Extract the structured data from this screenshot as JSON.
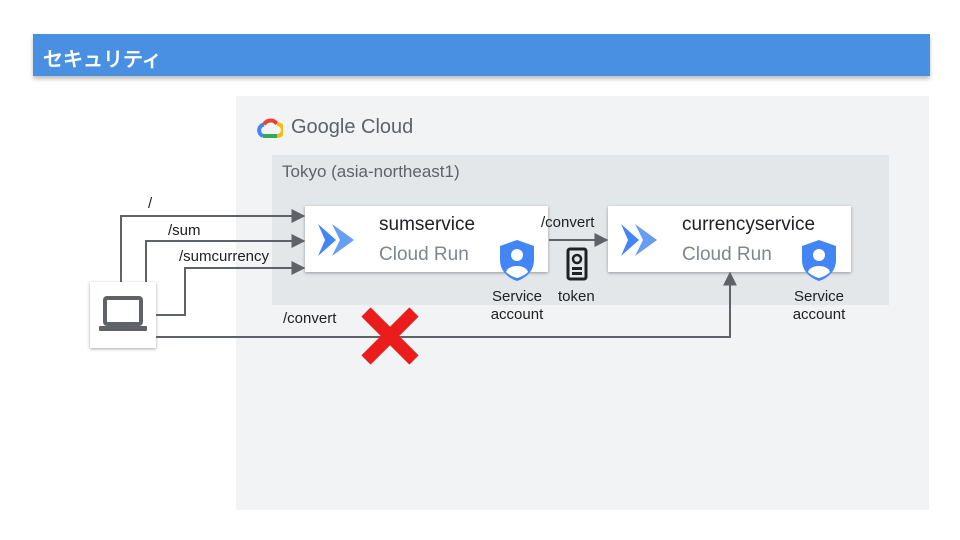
{
  "header": {
    "title": "セキュリティ"
  },
  "cloud": {
    "logo_text": "Google Cloud",
    "region_label": "Tokyo (asia-northeast1)"
  },
  "services": [
    {
      "name": "sumservice",
      "platform": "Cloud Run",
      "sa_label_line1": "Service",
      "sa_label_line2": "account"
    },
    {
      "name": "currencyservice",
      "platform": "Cloud Run",
      "sa_label_line1": "Service",
      "sa_label_line2": "account"
    }
  ],
  "routes": {
    "root": "/",
    "sum": "/sum",
    "sumcurrency": "/sumcurrency",
    "convert_internal": "/convert",
    "convert_blocked": "/convert"
  },
  "token": {
    "label": "token"
  },
  "colors": {
    "title_bar": "#4a90e2",
    "cloud_run": "#4285f4",
    "blocked": "#ea1c1c",
    "arrow": "#5f6368"
  },
  "icons": [
    "google-cloud-icon",
    "cloud-run-icon",
    "service-account-icon",
    "laptop-icon",
    "token-icon",
    "blocked-x-icon"
  ]
}
